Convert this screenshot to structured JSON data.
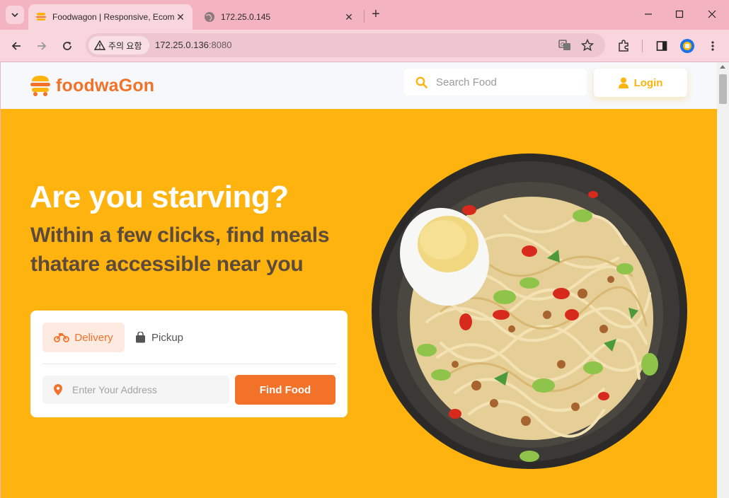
{
  "browser": {
    "tabs": [
      {
        "title": "Foodwagon | Responsive, Ecom",
        "active": true
      },
      {
        "title": "172.25.0.145",
        "active": false
      }
    ],
    "security_chip": "주의 요함",
    "url_host": "172.25.0.136",
    "url_port": ":8080"
  },
  "site": {
    "brand": "foodwaGon",
    "search_placeholder": "Search Food",
    "login_label": "Login"
  },
  "hero": {
    "title": "Are you starving?",
    "subtitle": "Within a few clicks, find meals thatare accessible near you"
  },
  "finder": {
    "tabs": [
      {
        "label": "Delivery",
        "active": true
      },
      {
        "label": "Pickup",
        "active": false
      }
    ],
    "address_placeholder": "Enter Your Address",
    "submit_label": "Find Food"
  },
  "colors": {
    "accent_yellow": "#ffb30e",
    "accent_orange": "#f17228",
    "tab_strip": "#f4b3c1"
  }
}
